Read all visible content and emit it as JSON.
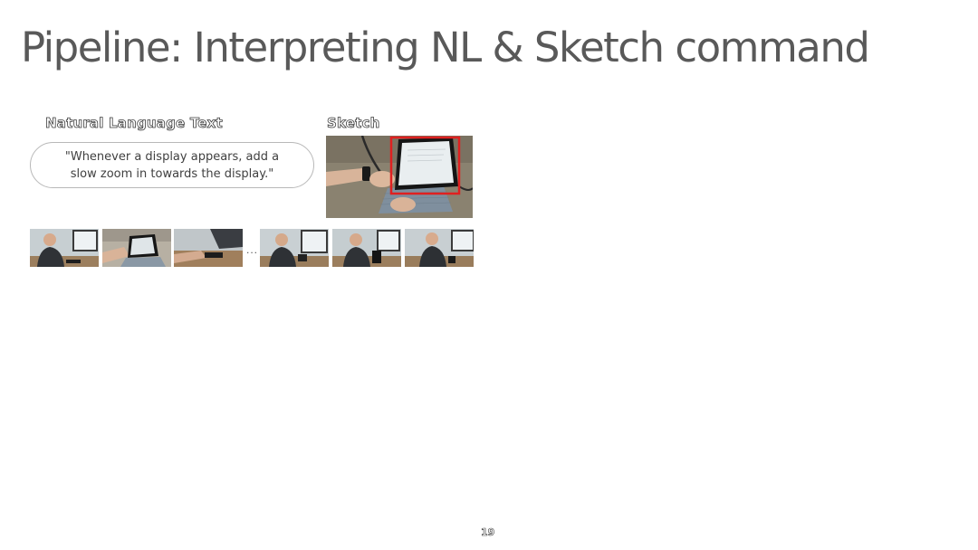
{
  "slide": {
    "title": "Pipeline: Interpreting NL & Sketch command",
    "page_number": "19"
  },
  "natural_language": {
    "label": "Natural Language Text",
    "command": "\"Whenever a display appears, add a slow zoom in towards the display.\""
  },
  "sketch": {
    "label": "Sketch",
    "image": "photo of a hand using a tablet on a desk, with a red sketch rectangle drawn around the tablet display",
    "highlight_color": "#e02020"
  },
  "video_frames": {
    "ellipsis": "...",
    "frames": [
      "man-at-desk-frame",
      "tablet-closeup-frame",
      "hands-on-desk-frame",
      "man-at-desk-frame",
      "man-holding-tablet-frame",
      "man-holding-tablet-frame"
    ]
  }
}
